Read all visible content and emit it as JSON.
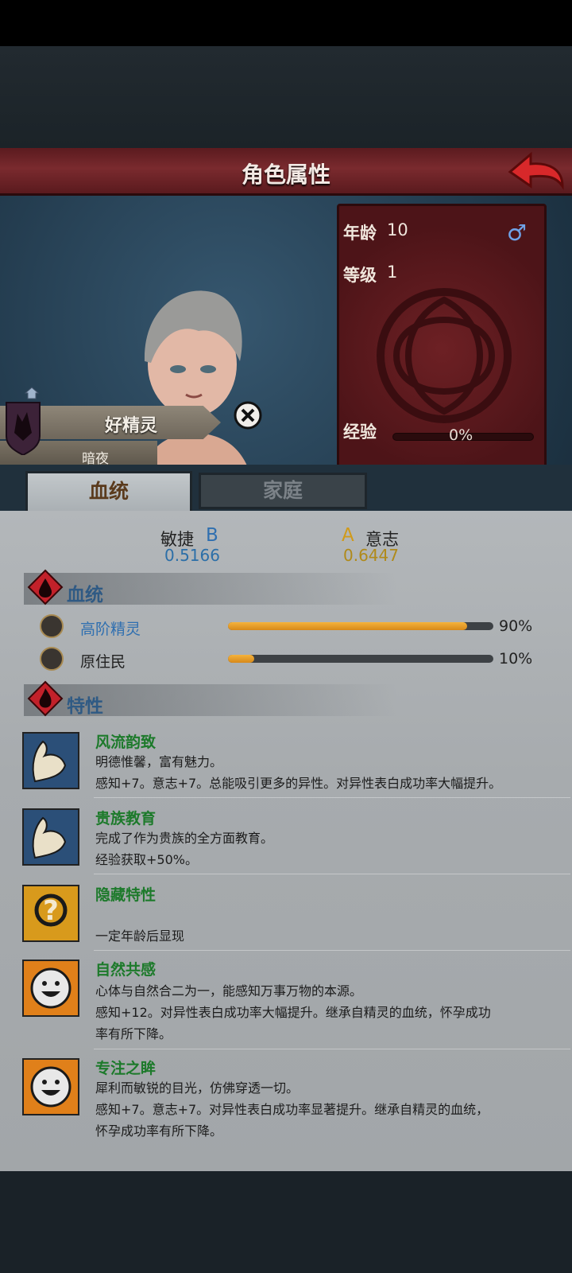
{
  "header": {
    "title": "角色属性"
  },
  "stats": {
    "age_label": "年龄",
    "age_value": "10",
    "level_label": "等级",
    "level_value": "1",
    "exp_label": "经验",
    "exp_value": "0%",
    "exp_fraction": 0,
    "gender_icon": "male-symbol-icon"
  },
  "character": {
    "name": "好精灵",
    "house": "暗夜"
  },
  "tabs": [
    {
      "label": "血统"
    },
    {
      "label": "家庭"
    }
  ],
  "attributes": [
    {
      "name": "敏捷",
      "grade": "B",
      "value": "0.5166"
    },
    {
      "name": "意志",
      "grade": "A",
      "value": "0.6447"
    }
  ],
  "bloodline": {
    "title": "血统",
    "items": [
      {
        "name": "高阶精灵",
        "percent": "90%",
        "fraction": 0.9
      },
      {
        "name": "原住民",
        "percent": "10%",
        "fraction": 0.1
      }
    ]
  },
  "traits_section": {
    "title": "特性"
  },
  "traits": [
    {
      "name": "风流韵致",
      "lines": [
        "明德惟馨，富有魅力。",
        "感知+7。意志+7。总能吸引更多的异性。对异性表白成功率大幅提升。"
      ],
      "icon": "muscle-arm-icon"
    },
    {
      "name": "贵族教育",
      "lines": [
        "完成了作为贵族的全方面教育。",
        "经验获取+50%。"
      ],
      "icon": "muscle-arm-icon"
    },
    {
      "name": "隐藏特性",
      "lines": [
        "",
        "一定年龄后显现"
      ],
      "icon": "question-mark-icon"
    },
    {
      "name": "自然共感",
      "lines": [
        "心体与自然合二为一，能感知万事万物的本源。",
        "感知+12。对异性表白成功率大幅提升。继承自精灵的血统，怀孕成功",
        "率有所下降。"
      ],
      "icon": "smiley-face-icon"
    },
    {
      "name": "专注之眸",
      "lines": [
        "犀利而敏锐的目光，仿佛穿透一切。",
        "感知+7。意志+7。对异性表白成功率显著提升。继承自精灵的血统，",
        "怀孕成功率有所下降。"
      ],
      "icon": "smiley-face-icon"
    }
  ],
  "colors": {
    "header_red": "#7a2a2e",
    "bar_orange": "#f0aa30",
    "trait_name_green": "#1d7a2b",
    "attr_value_blue": "#2c6fa8",
    "bloodline_name_blue": "#2f6fb0"
  }
}
